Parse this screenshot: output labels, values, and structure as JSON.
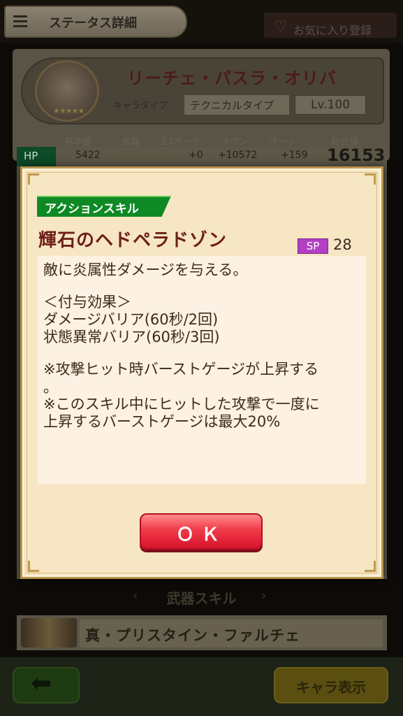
{
  "header": {
    "title": "ステータス詳細",
    "favorite_label": "お気に入り登録",
    "heart_icon": "♡"
  },
  "character": {
    "name": "リーチェ・パスラ・オリバ",
    "type_label": "キャラタイプ",
    "type_value": "テクニカルタイプ",
    "level": "Lv.100",
    "stars": "★★★★★"
  },
  "stats": {
    "headers": [
      "基本値",
      "武器",
      "EXボード",
      "タウン",
      "オート",
      "総合値"
    ],
    "hp": {
      "label": "HP",
      "base": "5422",
      "ex_board": "+0",
      "town": "+10572",
      "auto": "+159",
      "total": "16153"
    }
  },
  "weapon": {
    "section_title": "武器スキル",
    "name": "真・プリスタイン・ファルチェ",
    "prev_arrow": "‹",
    "next_arrow": "›"
  },
  "footer": {
    "back_arrow": "⬅",
    "chara_display_label": "キャラ表示"
  },
  "modal": {
    "skill_type": "アクションスキル",
    "skill_name": "輝石のヘドペラドゾン",
    "sp_label": "SP",
    "sp_value": "28",
    "description": [
      "敵に炎属性ダメージを与える。",
      "",
      "＜付与効果＞",
      "ダメージバリア(60秒/2回)",
      "状態異常バリア(60秒/3回)",
      "",
      "※攻撃ヒット時バーストゲージが上昇する",
      "。",
      "※このスキル中にヒットした攻撃で一度に",
      "上昇するバーストゲージは最大20%"
    ],
    "ok_label": "ＯＫ"
  }
}
